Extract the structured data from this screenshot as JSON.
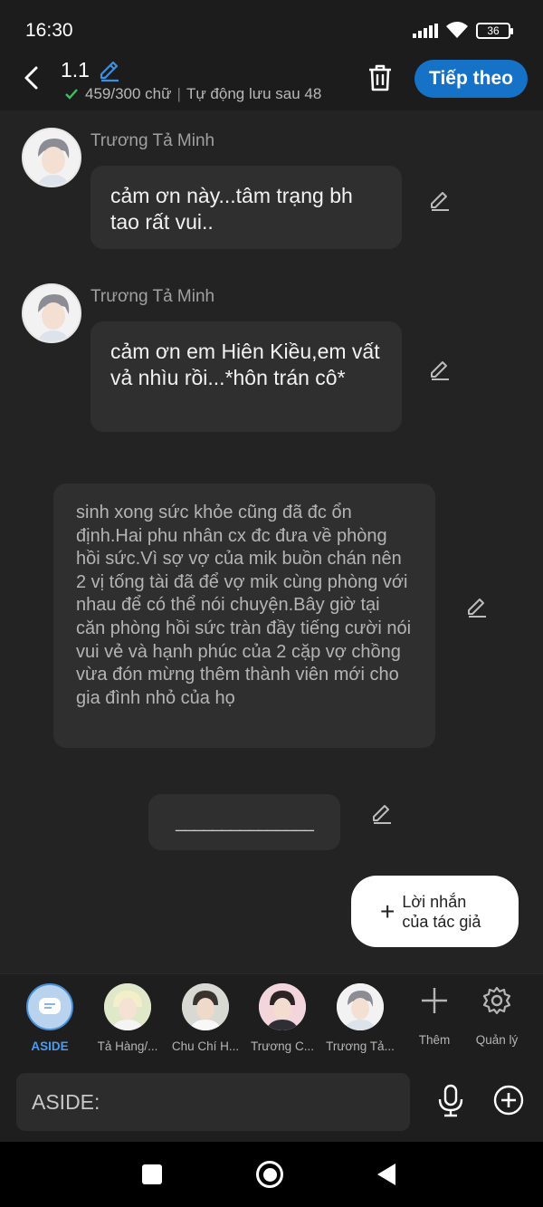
{
  "status_bar": {
    "time": "16:30",
    "battery": "36"
  },
  "header": {
    "title": "1.1",
    "word_count": "459/300 chữ",
    "autosave": "Tự động lưu sau 48",
    "next_label": "Tiếp theo"
  },
  "messages": [
    {
      "sender": "Trương Tả Minh",
      "text": "cảm ơn này...tâm trạng bh tao rất vui.."
    },
    {
      "sender": "Trương Tả Minh",
      "text": "cảm ơn em Hiên Kiều,em vất vả nhìu rồi...*hôn trán cô*"
    }
  ],
  "narration": "sinh xong sức khỏe cũng đã đc ổn định.Hai phu nhân cx đc đưa về phòng hồi sức.Vì sợ vợ của mik buồn chán nên 2 vị tống tài đã để vợ mik cùng phòng với nhau để có thể nói chuyện.Bây giờ tại căn phòng hồi sức tràn đầy tiếng cười nói vui vẻ và hạnh phúc của 2 cặp vợ chồng vừa đón mừng thêm thành viên mới cho gia đình nhỏ của họ",
  "divider_text": "_______________",
  "author_note": {
    "line1": "Lời nhắn",
    "line2": "của tác giả"
  },
  "characters": [
    {
      "label": "ASIDE",
      "selected": true
    },
    {
      "label": "Tả Hàng/..."
    },
    {
      "label": "Chu Chí H..."
    },
    {
      "label": "Trương C..."
    },
    {
      "label": "Trương Tả..."
    }
  ],
  "tools": {
    "add_label": "Thêm",
    "manage_label": "Quản lý"
  },
  "input": {
    "placeholder": "ASIDE:"
  },
  "colors": {
    "accent": "#1672c7",
    "background": "#232323",
    "bubble": "#2f2f2f",
    "check": "#3fbf5f"
  }
}
